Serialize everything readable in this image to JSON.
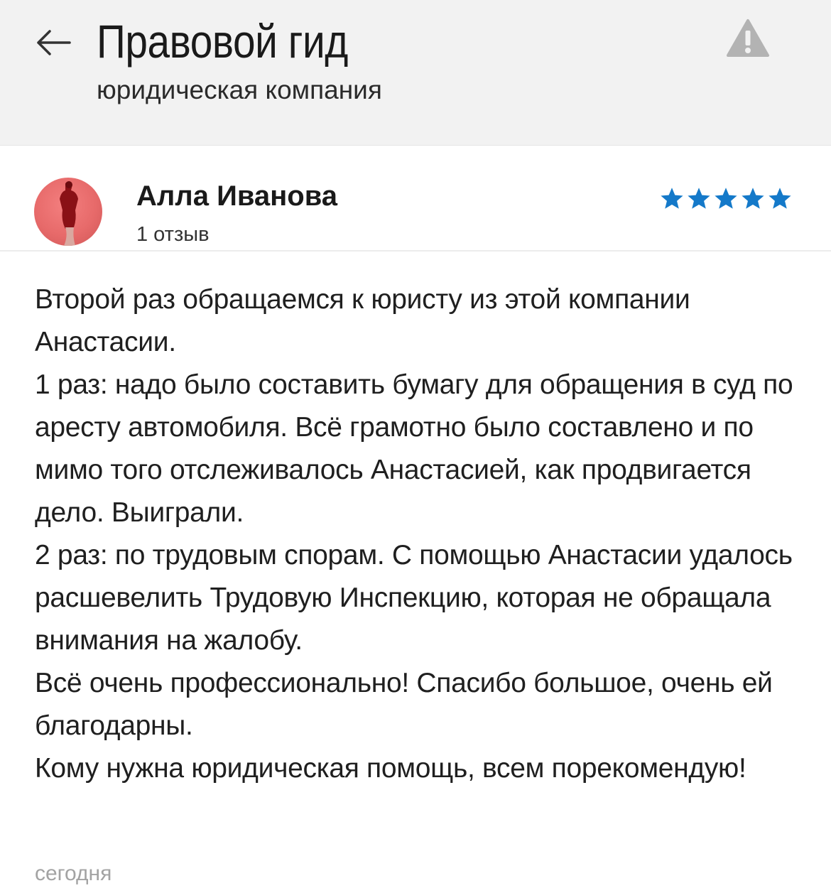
{
  "header": {
    "back_icon": "arrow-left-icon",
    "title": "Правовой гид",
    "subtitle": "юридическая компания",
    "warning_icon": "warning-triangle-icon"
  },
  "review": {
    "author_name": "Алла Иванова",
    "review_count": "1 отзыв",
    "rating": 5,
    "rating_max": 5,
    "star_color": "#1479c9",
    "text": "Второй раз обращаемся к юристу из этой компании Анастасии.\n1 раз: надо было составить бумагу для обращения в суд по аресту автомобиля. Всё грамотно было составлено и по мимо того отслеживалось Анастасией, как продвигается дело. Выиграли.\n2 раз: по трудовым спорам. С помощью Анастасии удалось расшевелить Трудовую Инспекцию, которая не обращала внимания на жалобу.\nВсё очень профессионально! Спасибо большое, очень ей благодарны.\nКому нужна юридическая помощь, всем порекомендую!",
    "date": "сегодня"
  },
  "colors": {
    "header_bg": "#f2f2f2",
    "warning_icon": "#b3b3b3",
    "date_text": "#a3a3a3"
  }
}
